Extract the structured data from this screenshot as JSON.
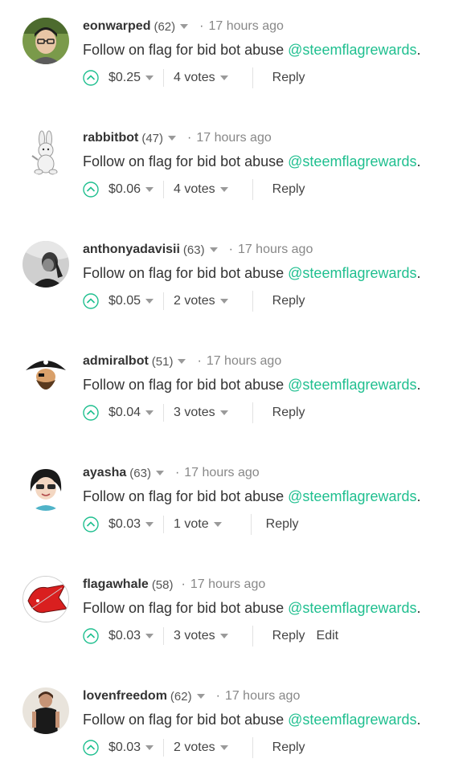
{
  "comments": [
    {
      "author": "eonwarped",
      "rep": "(62)",
      "time": "17 hours ago",
      "body": "Follow on flag for bid bot abuse ",
      "mention": "@steemflagrewards",
      "period": ".",
      "payout": "$0.25",
      "votes": "4 votes",
      "reply": "Reply",
      "edit": ""
    },
    {
      "author": "rabbitbot",
      "rep": "(47)",
      "time": "17 hours ago",
      "body": "Follow on flag for bid bot abuse ",
      "mention": "@steemflagrewards",
      "period": ".",
      "payout": "$0.06",
      "votes": "4 votes",
      "reply": "Reply",
      "edit": ""
    },
    {
      "author": "anthonyadavisii",
      "rep": "(63)",
      "time": "17 hours ago",
      "body": "Follow on flag for bid bot abuse ",
      "mention": "@steemflagrewards",
      "period": ".",
      "payout": "$0.05",
      "votes": "2 votes",
      "reply": "Reply",
      "edit": ""
    },
    {
      "author": "admiralbot",
      "rep": "(51)",
      "time": "17 hours ago",
      "body": "Follow on flag for bid bot abuse ",
      "mention": "@steemflagrewards",
      "period": ".",
      "payout": "$0.04",
      "votes": "3 votes",
      "reply": "Reply",
      "edit": ""
    },
    {
      "author": "ayasha",
      "rep": "(63)",
      "time": "17 hours ago",
      "body": "Follow on flag for bid bot abuse ",
      "mention": "@steemflagrewards",
      "period": ".",
      "payout": "$0.03",
      "votes": "1 vote",
      "reply": "Reply",
      "edit": ""
    },
    {
      "author": "flagawhale",
      "rep": "(58)",
      "time": "17 hours ago",
      "body": "Follow on flag for bid bot abuse ",
      "mention": "@steemflagrewards",
      "period": ".",
      "payout": "$0.03",
      "votes": "3 votes",
      "reply": "Reply",
      "edit": "Edit"
    },
    {
      "author": "lovenfreedom",
      "rep": "(62)",
      "time": "17 hours ago",
      "body": "Follow on flag for bid bot abuse ",
      "mention": "@steemflagrewards",
      "period": ".",
      "payout": "$0.03",
      "votes": "2 votes",
      "reply": "Reply",
      "edit": ""
    }
  ],
  "separator_dot": "·",
  "colors": {
    "accent": "#1fbf8f",
    "text": "#333333",
    "muted": "#888888"
  },
  "icons": {
    "upvote": "upvote-circle-chevron-icon",
    "dropdown": "caret-down-icon"
  }
}
